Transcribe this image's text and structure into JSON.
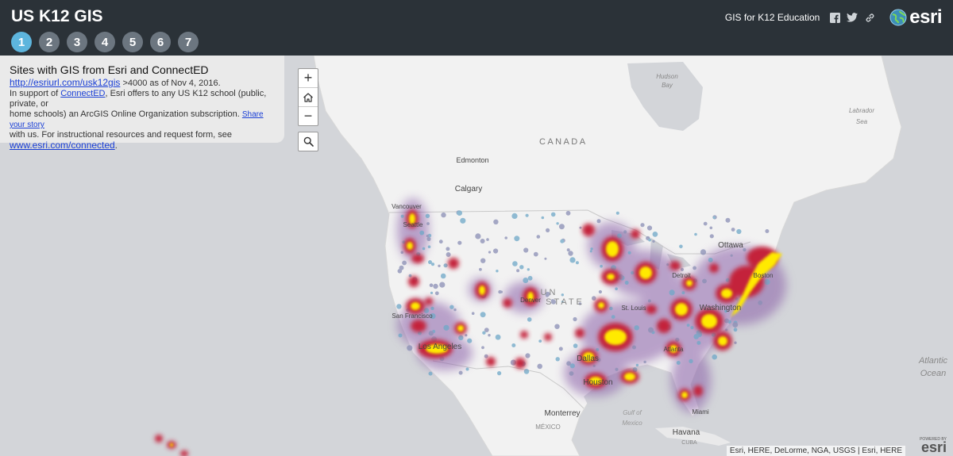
{
  "header": {
    "title": "US K12 GIS",
    "steps": [
      "1",
      "2",
      "3",
      "4",
      "5",
      "6",
      "7"
    ],
    "subtitle": "GIS for K12 Education",
    "brand": "esri"
  },
  "info": {
    "title": "Sites with GIS from Esri and ConnectED",
    "link1": "http://esriurl.com/usk12gis",
    "count_text": ">4000 as of Nov 4, 2016.",
    "l2_a": "In support of ",
    "l2_link": "ConnectED",
    "l2_b": ", Esri offers to any US K12 school (public, private, or",
    "l3_a": "home schools) an ArcGIS Online Organization subscription. ",
    "l3_link": "Share your story",
    "l4": "with us. For instructional resources and request form, see",
    "link2": "www.esri.com/connected",
    "link2_after": "."
  },
  "zoom": {
    "in": "+",
    "out": "−"
  },
  "labels": {
    "canada": "C A N A D A",
    "hudson1": "Hudson",
    "hudson2": "Bay",
    "labrador1": "Labrador",
    "labrador2": "Sea",
    "edmonton": "Edmonton",
    "calgary": "Calgary",
    "vancouver": "Vancouver",
    "seattle": "Seattle",
    "ottawa": "Ottawa",
    "detroit": "Detroit",
    "boston": "Boston",
    "washington": "Washington",
    "denver": "Denver",
    "us1": "U N",
    "us2": "S T A T E",
    "stlouis": "St. Louis",
    "sanfrancisco": "San Francisco",
    "losangeles": "Los Angeles",
    "atlanta": "Atlanta",
    "dallas": "Dallas",
    "houston": "Houston",
    "atlantic1": "Atlantic",
    "atlantic2": "Ocean",
    "gulf1": "Gulf of",
    "gulf2": "Mexico",
    "monterrey": "Monterrey",
    "mexico": "MÉXICO",
    "miami": "Miami",
    "havana": "Havana",
    "cuba": "CUBA"
  },
  "attribution": "Esri, HERE, DeLorme, NGA, USGS | Esri, HERE",
  "powered_by": "POWERED BY",
  "powered_brand": "esri"
}
